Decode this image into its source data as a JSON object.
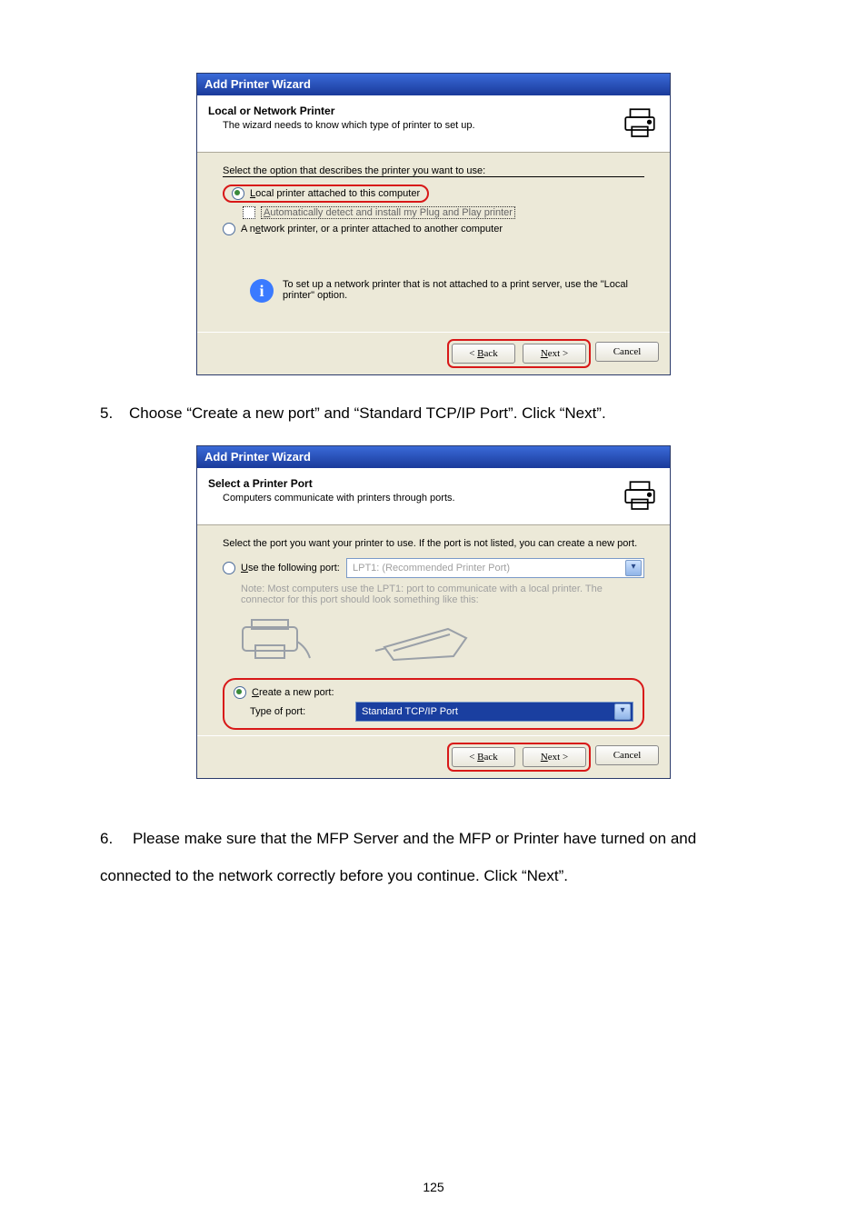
{
  "dialog1": {
    "title": "Add Printer Wizard",
    "header_title": "Local or Network Printer",
    "header_sub": "The wizard needs to know which type of printer to set up.",
    "select_line": "Select the option that describes the printer you want to use:",
    "opt_local": "Local printer attached to this computer",
    "opt_auto": "Automatically detect and install my Plug and Play printer",
    "opt_network": "A network printer, or a printer attached to another computer",
    "info_text": "To set up a network printer that is not attached to a print server, use the \"Local printer\" option.",
    "back": "< Back",
    "next": "Next >",
    "cancel": "Cancel"
  },
  "step5": "Choose “Create a new port” and “Standard TCP/IP Port”. Click “Next”.",
  "dialog2": {
    "title": "Add Printer Wizard",
    "header_title": "Select a Printer Port",
    "header_sub": "Computers communicate with printers through ports.",
    "select_line": "Select the port you want your printer to use.  If the port is not listed, you can create a new port.",
    "opt_use": "Use the following port:",
    "use_value": "LPT1: (Recommended Printer Port)",
    "note": "Note: Most computers use the LPT1: port to communicate with a local printer. The connector for this port should look something like this:",
    "opt_create": "Create a new port:",
    "type_label": "Type of port:",
    "type_value": "Standard TCP/IP Port",
    "back": "< Back",
    "next": "Next >",
    "cancel": "Cancel"
  },
  "step6": "Please make sure that the MFP Server and the MFP or Printer have turned on and connected to the network correctly before you continue. Click “Next”.",
  "page_number": "125"
}
